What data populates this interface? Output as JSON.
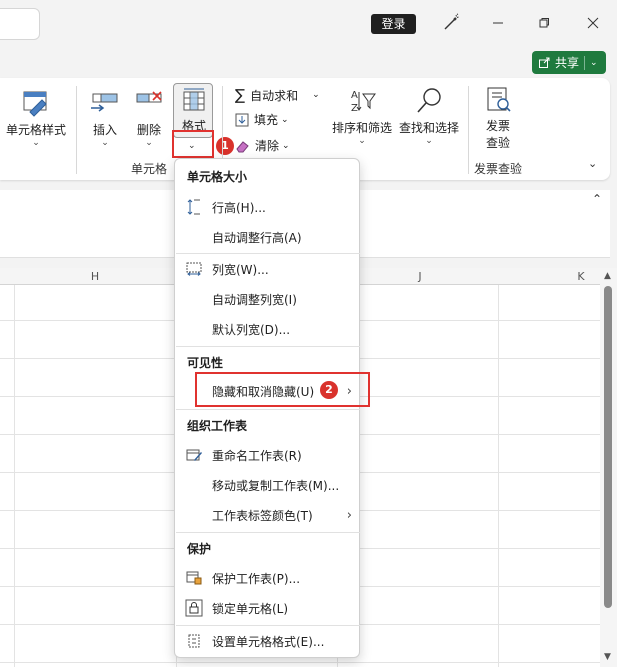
{
  "titlebar": {
    "login_label": "登录"
  },
  "share": {
    "label": "共享"
  },
  "ribbon": {
    "cell_style_label": "单元格样式",
    "insert_label": "插入",
    "delete_label": "删除",
    "format_label": "格式",
    "cells_group_label": "单元格",
    "autosum_label": "自动求和",
    "fill_label": "填充",
    "clear_label": "清除",
    "sort_filter_label": "排序和筛选",
    "find_select_label": "查找和选择",
    "invoice_label_1": "发票",
    "invoice_label_2": "查验",
    "invoice_group_label": "发票查验"
  },
  "grid": {
    "columns": [
      "H",
      "J",
      "K"
    ]
  },
  "menu": {
    "section_cell_size": "单元格大小",
    "row_height": "行高(H)...",
    "autofit_row": "自动调整行高(A)",
    "col_width": "列宽(W)...",
    "autofit_col": "自动调整列宽(I)",
    "default_width": "默认列宽(D)...",
    "section_visibility": "可见性",
    "hide_unhide": "隐藏和取消隐藏(U)",
    "section_organize": "组织工作表",
    "rename_sheet": "重命名工作表(R)",
    "move_copy": "移动或复制工作表(M)...",
    "tab_color": "工作表标签颜色(T)",
    "section_protect": "保护",
    "protect_sheet": "保护工作表(P)...",
    "lock_cell": "锁定单元格(L)",
    "format_cells": "设置单元格格式(E)..."
  },
  "badges": {
    "step1": "1",
    "step2": "2"
  },
  "colors": {
    "accent_red": "#e0322f",
    "share_green": "#1f7a3e"
  }
}
